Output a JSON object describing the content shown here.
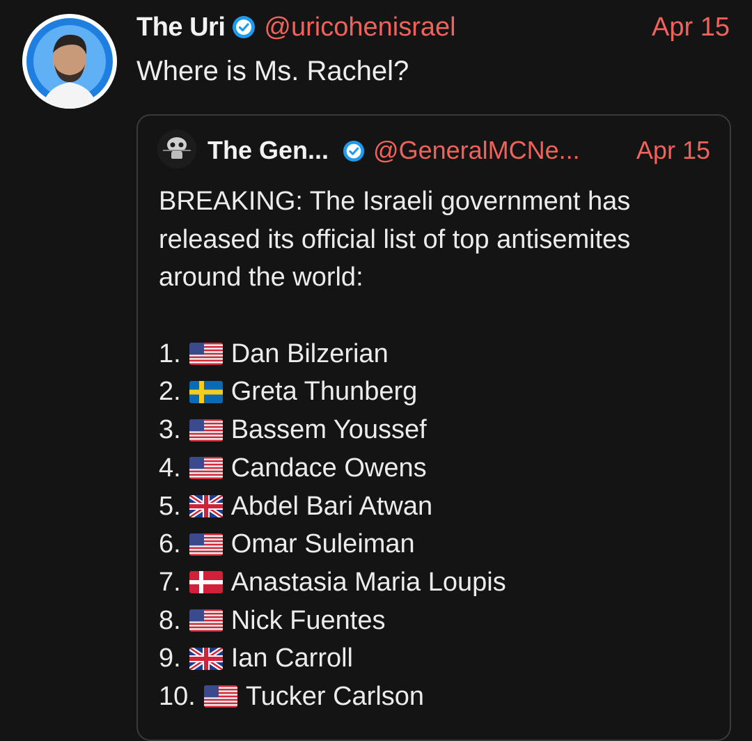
{
  "tweet": {
    "author_name": "The Uri",
    "handle": "@uricohenisrael",
    "date": "Apr 15",
    "text": "Where is Ms. Rachel?",
    "avatar_icon": "profile-photo",
    "verified_icon": "verified-check-icon"
  },
  "quoted_tweet": {
    "author_name": "The Gen...",
    "handle": "@GeneralMCNe...",
    "date": "Apr 15",
    "text_lines": [
      "BREAKING: The Israeli government has",
      "released its official list of top antisemites",
      "around the world:"
    ],
    "list": [
      {
        "num": "1.",
        "flag": "us",
        "name": "Dan Bilzerian"
      },
      {
        "num": "2.",
        "flag": "se",
        "name": "Greta Thunberg"
      },
      {
        "num": "3.",
        "flag": "us",
        "name": "Bassem Youssef"
      },
      {
        "num": "4.",
        "flag": "us",
        "name": "Candace Owens"
      },
      {
        "num": "5.",
        "flag": "gb",
        "name": "Abdel Bari Atwan"
      },
      {
        "num": "6.",
        "flag": "us",
        "name": "Omar Suleiman"
      },
      {
        "num": "7.",
        "flag": "dk",
        "name": "Anastasia Maria Loupis"
      },
      {
        "num": "8.",
        "flag": "us",
        "name": "Nick Fuentes"
      },
      {
        "num": "9.",
        "flag": "gb",
        "name": "Ian Carroll"
      },
      {
        "num": "10.",
        "flag": "us",
        "name": "Tucker Carlson"
      }
    ]
  },
  "colors": {
    "background": "#141414",
    "accent": "#f0625a",
    "verified_blue": "#1d9bf0",
    "border": "#3a3a3a"
  }
}
